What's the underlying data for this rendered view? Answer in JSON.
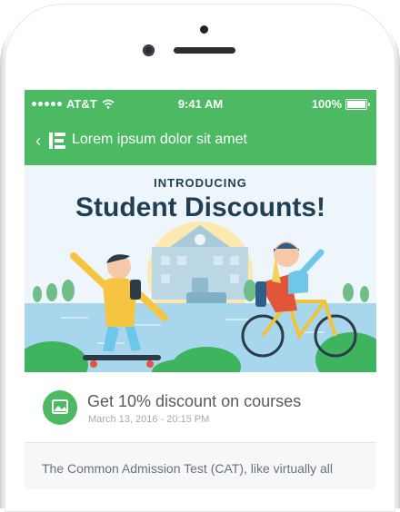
{
  "status_bar": {
    "carrier": "AT&T",
    "time": "9:41 AM",
    "battery": "100%"
  },
  "nav": {
    "title": "Lorem ipsum dolor sit amet"
  },
  "banner": {
    "subtitle": "INTRODUCING",
    "title": "Student Discounts!"
  },
  "card": {
    "title": "Get 10% discount on courses",
    "date": "March 13, 2016 - 20:15 PM"
  },
  "body": {
    "text": "The Common Admission Test (CAT), like virtually all"
  },
  "colors": {
    "brand_green": "#4cb963",
    "heading_navy": "#1f3f55"
  },
  "icons": {
    "back": "chevron-left-icon",
    "logo": "app-logo-icon",
    "card": "image-icon",
    "wifi": "wifi-icon",
    "battery": "battery-icon"
  }
}
